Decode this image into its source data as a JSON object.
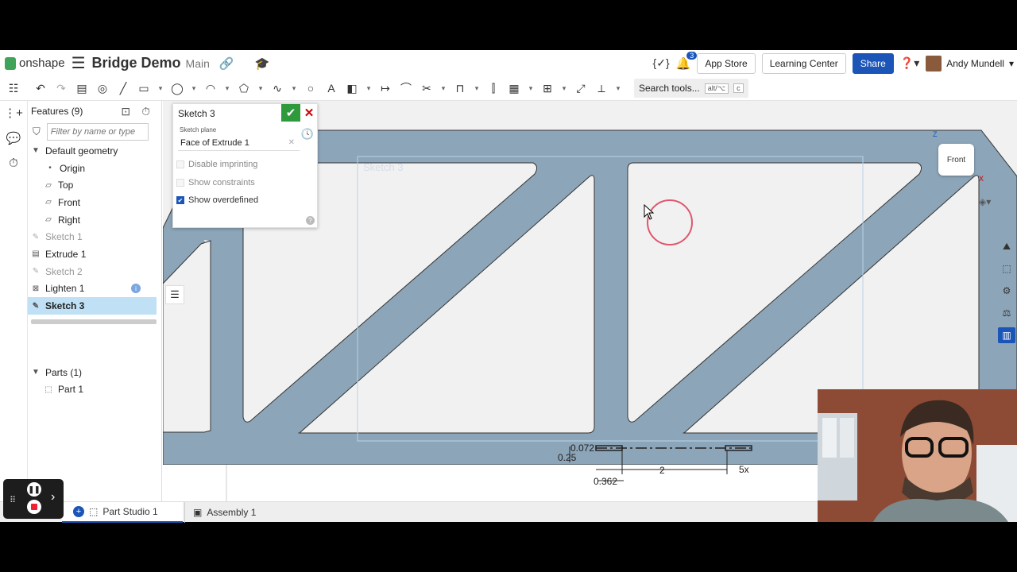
{
  "header": {
    "logo_text": "onshape",
    "doc_title": "Bridge Demo",
    "branch": "Main",
    "notification_count": "3",
    "app_store": "App Store",
    "learning_center": "Learning Center",
    "share": "Share",
    "user_name": "Andy Mundell"
  },
  "toolbar": {
    "search_tools": "Search tools...",
    "shortcut_1": "alt/⌥",
    "shortcut_2": "c"
  },
  "features": {
    "title": "Features (9)",
    "filter_placeholder": "Filter by name or type",
    "default_geometry": "Default geometry",
    "items": [
      {
        "label": "Origin"
      },
      {
        "label": "Top"
      },
      {
        "label": "Front"
      },
      {
        "label": "Right"
      },
      {
        "label": "Sketch 1"
      },
      {
        "label": "Extrude 1"
      },
      {
        "label": "Sketch 2"
      },
      {
        "label": "Lighten 1"
      },
      {
        "label": "Sketch 3"
      }
    ],
    "parts_header": "Parts (1)",
    "parts": [
      {
        "label": "Part 1"
      }
    ]
  },
  "sketch_dialog": {
    "title": "Sketch 3",
    "plane_label": "Sketch plane",
    "plane_value": "Face of Extrude 1",
    "options": [
      {
        "label": "Disable imprinting",
        "checked": false
      },
      {
        "label": "Show constraints",
        "checked": false
      },
      {
        "label": "Show overdefined",
        "checked": true
      }
    ]
  },
  "viewport": {
    "sketch_watermark": "Sketch 3",
    "view_cube_label": "Front",
    "axis_z": "Z",
    "axis_x": "X",
    "dimensions": {
      "d1": "0.072",
      "d2": "0.25",
      "d3": "2",
      "d4": "5x",
      "d5": "0.362"
    }
  },
  "tabs": [
    {
      "label": "Part Studio 1",
      "active": true
    },
    {
      "label": "Assembly 1",
      "active": false
    }
  ],
  "colors": {
    "part_fill": "#8ca5b8",
    "accent": "#1b55b8",
    "confirm_green": "#2e9a3b",
    "sketch_circle": "#e0566e"
  }
}
